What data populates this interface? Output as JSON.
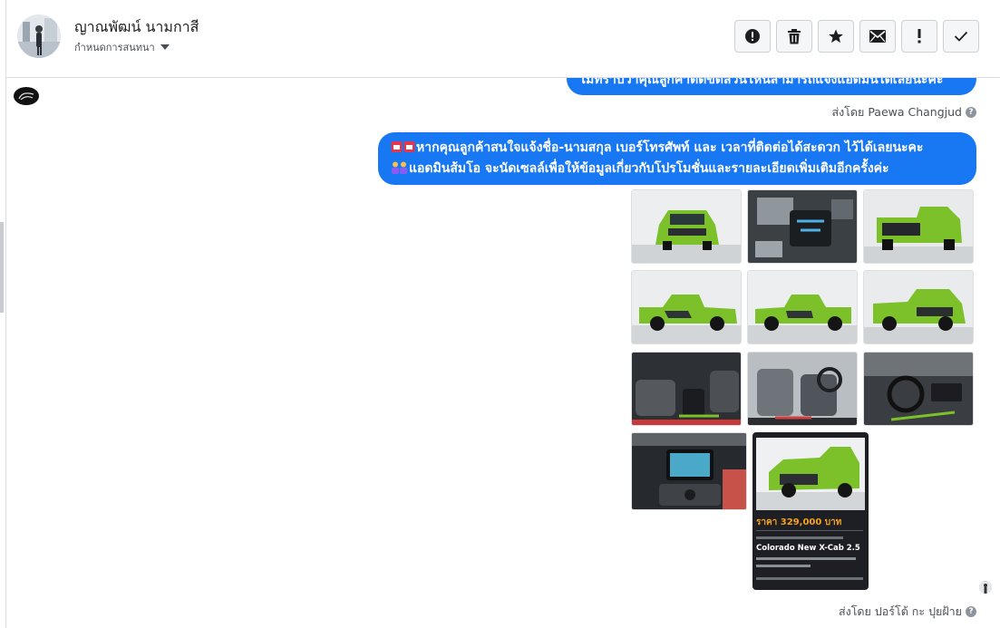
{
  "header": {
    "contact_name": "ญาณพัฒน์ นามกาสี",
    "assign_label": "กำหนดการสนทนา"
  },
  "actions": [
    {
      "name": "mark-spam",
      "icon": "alert-circle-icon"
    },
    {
      "name": "delete",
      "icon": "trash-icon"
    },
    {
      "name": "star",
      "icon": "star-icon"
    },
    {
      "name": "mark-unread",
      "icon": "envelope-icon"
    },
    {
      "name": "follow-up",
      "icon": "exclamation-icon"
    },
    {
      "name": "mark-done",
      "icon": "check-icon"
    }
  ],
  "messages": {
    "top_partial_text": "ไม่ทราบว่าคุณลูกค้าติดขัดส่วนไหนสามารถแจ้งแอดมินได้เลยนะคะ",
    "sent_by_1": "ส่งโดย Paewa Changjud",
    "bubble_line_1": "หากคุณลูกค้าสนใจแจ้งชื่อ-นามสกุล เบอร์โทรศัพท์ และ เวลาที่ติดต่อได้สะดวก ไว้ได้เลยนะคะ",
    "bubble_line_2": "แอดมินส้มโอ จะนัดเซลล์เพื่อให้ข้อมูลเกี่ยวกับโปรโมชั่นและรายละเอียดเพิ่มเติมอีกครั้งค่ะ",
    "sent_by_2": "ส่งโดย ปอร์โต้ กะ ปุยฝ้าย"
  },
  "promo_card": {
    "price": "ราคา 329,000 บาท",
    "model": "Colorado New X-Cab 2.5"
  },
  "colors": {
    "accent": "#1877f2",
    "car_green": "#7dc12a"
  }
}
